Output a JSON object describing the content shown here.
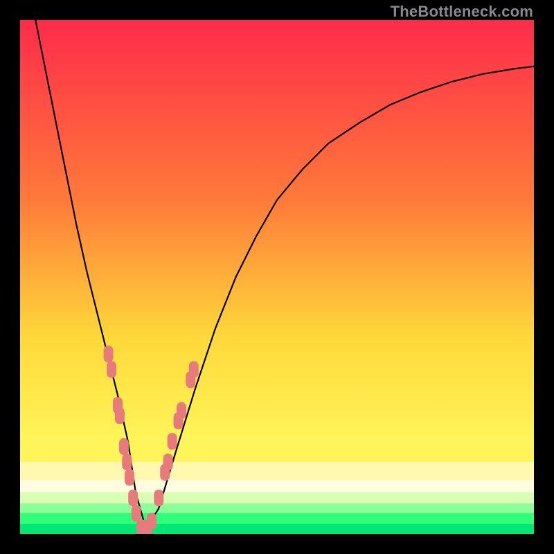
{
  "watermark": "TheBottleneck.com",
  "colors": {
    "top": "#ff2a4b",
    "mid_upper": "#ff7a3a",
    "mid": "#ffd93a",
    "mid_lower": "#fff55a",
    "band1": "#fff9b0",
    "band2": "#fffde0",
    "band3": "#d8ffb4",
    "band4": "#8bff9a",
    "band5": "#2fff7a",
    "band6": "#00e874",
    "curve": "#000000",
    "marker_fill": "#e77b7b",
    "marker_stroke": "#c84f4f"
  },
  "chart_data": {
    "type": "line",
    "title": "",
    "xlabel": "",
    "ylabel": "",
    "xlim": [
      0,
      100
    ],
    "ylim": [
      0,
      100
    ],
    "series": [
      {
        "name": "bottleneck-curve",
        "x": [
          3,
          5,
          7,
          9,
          11,
          13,
          15,
          17,
          19,
          21,
          22.5,
          24.5,
          27,
          30,
          34,
          38,
          42,
          46,
          50,
          55,
          60,
          66,
          72,
          78,
          84,
          90,
          96,
          100
        ],
        "y": [
          100,
          90,
          80,
          70,
          60,
          51,
          43,
          35,
          27,
          18,
          8,
          1,
          5,
          15,
          28,
          40,
          50,
          58,
          65,
          71,
          76,
          80,
          83.5,
          86,
          88,
          89.5,
          90.5,
          91
        ]
      }
    ],
    "markers": {
      "name": "highlight-points",
      "points": [
        {
          "x": 17.2,
          "y": 35
        },
        {
          "x": 17.8,
          "y": 32
        },
        {
          "x": 19.0,
          "y": 25
        },
        {
          "x": 19.4,
          "y": 23
        },
        {
          "x": 20.2,
          "y": 17
        },
        {
          "x": 20.8,
          "y": 14
        },
        {
          "x": 21.3,
          "y": 11
        },
        {
          "x": 22.0,
          "y": 7
        },
        {
          "x": 22.6,
          "y": 4
        },
        {
          "x": 23.6,
          "y": 1.2
        },
        {
          "x": 24.8,
          "y": 1.2
        },
        {
          "x": 25.6,
          "y": 2.5
        },
        {
          "x": 27.0,
          "y": 7
        },
        {
          "x": 28.2,
          "y": 12
        },
        {
          "x": 28.8,
          "y": 14
        },
        {
          "x": 29.6,
          "y": 18
        },
        {
          "x": 30.8,
          "y": 22
        },
        {
          "x": 31.4,
          "y": 24
        },
        {
          "x": 33.2,
          "y": 30
        },
        {
          "x": 33.8,
          "y": 32
        }
      ]
    }
  }
}
